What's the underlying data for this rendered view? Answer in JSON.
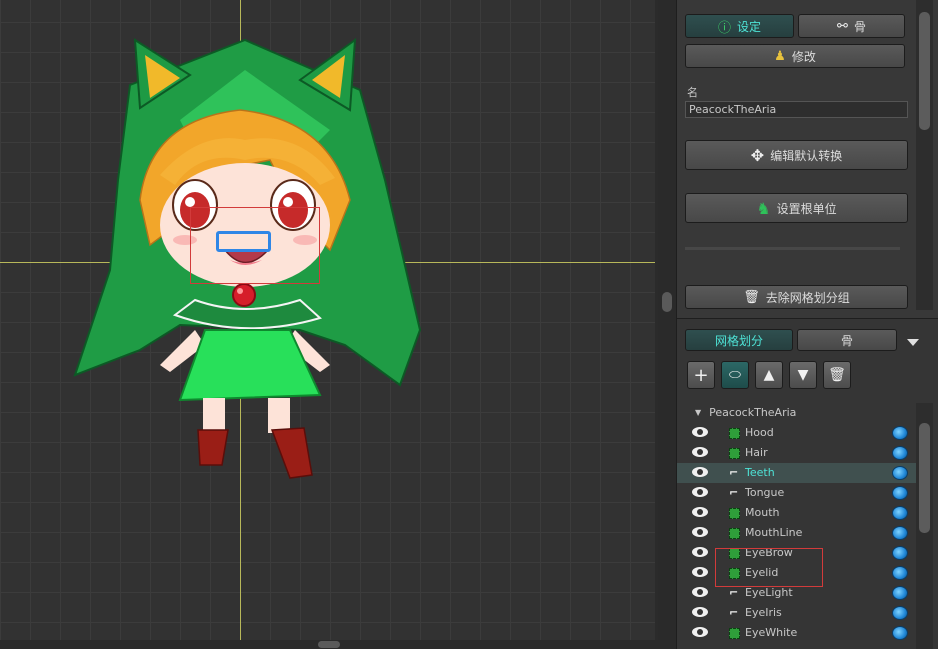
{
  "colors": {
    "accent_teal": "#4ee3d6",
    "selection_red": "#d23b3b",
    "selection_blue": "#2f86e6",
    "axis_yellow": "#b8b85a"
  },
  "top_tabs": [
    {
      "label": "设定",
      "icon": "info-icon",
      "active": true
    },
    {
      "label": "骨",
      "icon": "bone-icon",
      "active": false
    }
  ],
  "modify_button": "修改",
  "name_label": "名",
  "name_value": "PeacockTheAria",
  "edit_default_transform": "编辑默认转换",
  "set_root_unit": "设置根单位",
  "remove_mesh_group": "去除网格划分组",
  "lower_tabs": [
    {
      "label": "网格划分",
      "active": true
    },
    {
      "label": "骨",
      "active": false
    }
  ],
  "toolbar": {
    "add": "+",
    "mesh_group": "mesh-group-icon",
    "move_up": "move-up-icon",
    "move_down": "move-down-icon",
    "delete": "trash-icon"
  },
  "tree": {
    "root": "PeacockTheAria",
    "items": [
      {
        "label": "Hood",
        "type": "mesh",
        "selected": false
      },
      {
        "label": "Hair",
        "type": "mesh",
        "selected": false
      },
      {
        "label": "Teeth",
        "type": "bone",
        "selected": true
      },
      {
        "label": "Tongue",
        "type": "bone",
        "selected": false
      },
      {
        "label": "Mouth",
        "type": "mesh",
        "selected": false
      },
      {
        "label": "MouthLine",
        "type": "mesh",
        "selected": false
      },
      {
        "label": "EyeBrow",
        "type": "mesh",
        "selected": false
      },
      {
        "label": "Eyelid",
        "type": "mesh",
        "selected": false
      },
      {
        "label": "EyeLight",
        "type": "bone",
        "selected": false
      },
      {
        "label": "EyeIris",
        "type": "bone",
        "selected": false
      },
      {
        "label": "EyeWhite",
        "type": "mesh",
        "selected": false
      }
    ]
  }
}
